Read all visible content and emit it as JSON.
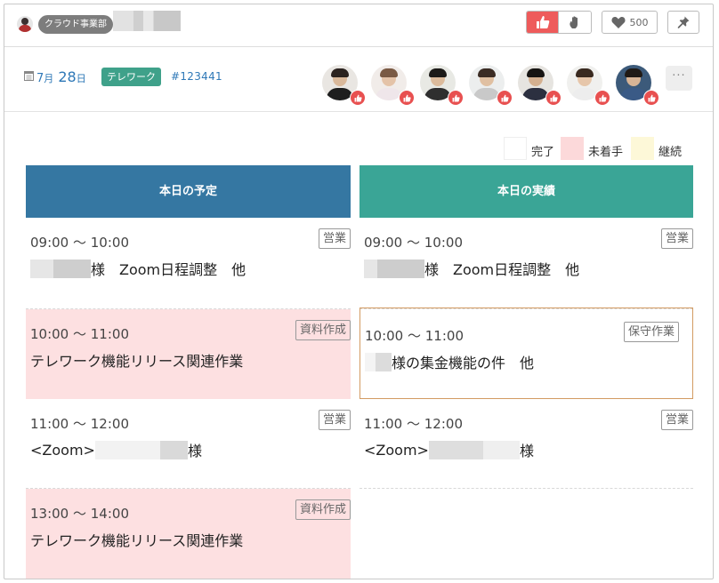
{
  "topbar": {
    "department": "クラウド事業部",
    "heart_count": "500"
  },
  "report": {
    "month": "7",
    "month_unit": "月",
    "day": "28",
    "day_unit": "日",
    "status": "テレワーク",
    "id": "#123441",
    "more_label": "···"
  },
  "legend": [
    {
      "label": "完了",
      "color": "#ffffff"
    },
    {
      "label": "未着手",
      "color": "#fcd9da"
    },
    {
      "label": "継続",
      "color": "#fdf8d8"
    }
  ],
  "columns": {
    "plan_title": "本日の予定",
    "actual_title": "本日の実績",
    "plan_color": "#3577a2",
    "actual_color": "#3aa596"
  },
  "plan": [
    {
      "time": "09:00 〜 10:00",
      "category": "営業",
      "title": "様　Zoom日程調整　他"
    },
    {
      "time": "10:00 〜 11:00",
      "category": "資料作成",
      "title": "テレワーク機能リリース関連作業"
    },
    {
      "time": "11:00 〜 12:00",
      "category": "営業",
      "title_prefix": "<Zoom>",
      "title": "様"
    },
    {
      "time": "13:00 〜 14:00",
      "category": "資料作成",
      "title": "テレワーク機能リリース関連作業"
    }
  ],
  "actual": [
    {
      "time": "09:00 〜 10:00",
      "category": "営業",
      "title": "様　Zoom日程調整　他"
    },
    {
      "time": "10:00 〜 11:00",
      "category": "保守作業",
      "title": "様の集金機能の件　他"
    },
    {
      "time": "11:00 〜 12:00",
      "category": "営業",
      "title_prefix": "<Zoom>",
      "title": "様"
    }
  ],
  "icons": {
    "calendar": "calendar-icon",
    "thumbs_up": "thumbs-up-icon",
    "hand": "raised-hand-icon",
    "heart": "heart-icon",
    "pin": "pin-icon"
  }
}
